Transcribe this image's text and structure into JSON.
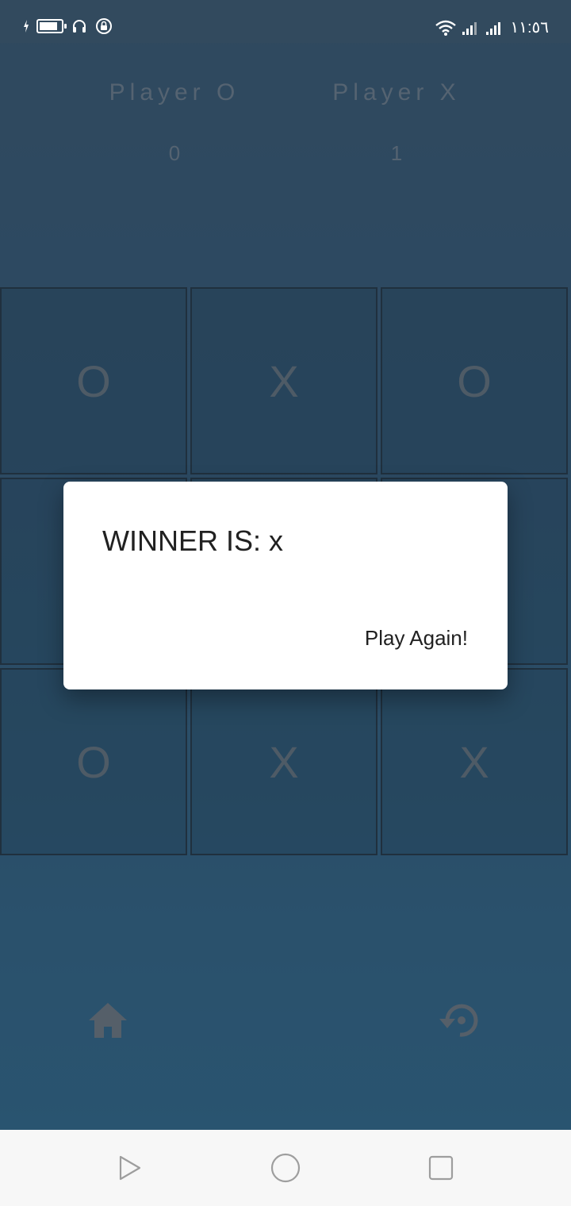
{
  "status_bar": {
    "time": "١١:٥٦",
    "icons": [
      "charging-bolt-icon",
      "battery-icon",
      "headphones-icon",
      "rotation-lock-icon",
      "wifi-icon",
      "signal-icon",
      "signal-icon"
    ]
  },
  "scoreboard": {
    "player_o": {
      "label": "Player O",
      "score": "0"
    },
    "player_x": {
      "label": "Player X",
      "score": "1"
    }
  },
  "board": {
    "cells": [
      "O",
      "X",
      "O",
      "",
      "",
      "",
      "O",
      "X",
      "X"
    ]
  },
  "dialog": {
    "title": "WINNER IS: x",
    "action_label": "Play Again!"
  },
  "actions": {
    "home_icon": "home-icon",
    "restart_icon": "restart-icon"
  },
  "nav_bar": {
    "icons": [
      "back-triangle-icon",
      "home-circle-icon",
      "recents-square-icon"
    ]
  },
  "colors": {
    "dialog_bg": "#ffffff",
    "board_line": "#2a3c4b",
    "mark_color": "#7f8a94"
  }
}
